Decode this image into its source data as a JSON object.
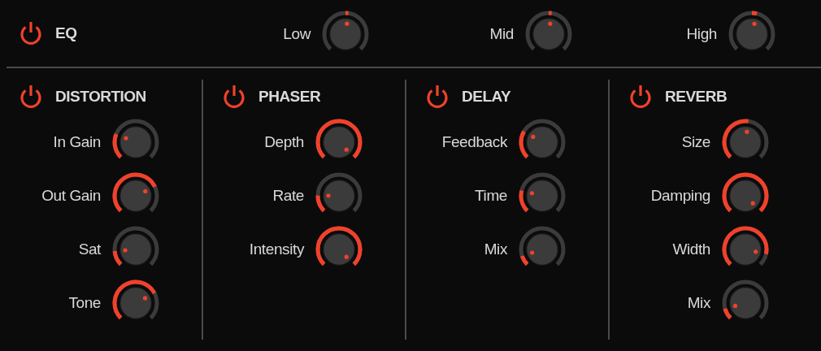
{
  "eq": {
    "title": "EQ",
    "on": true,
    "knobs": [
      {
        "label": "Low"
      },
      {
        "label": "Mid"
      },
      {
        "label": "High"
      }
    ]
  },
  "effects": [
    {
      "title": "DISTORTION",
      "on": true,
      "knobs": [
        {
          "label": "In Gain"
        },
        {
          "label": "Out Gain"
        },
        {
          "label": "Sat"
        },
        {
          "label": "Tone"
        }
      ]
    },
    {
      "title": "PHASER",
      "on": true,
      "knobs": [
        {
          "label": "Depth"
        },
        {
          "label": "Rate"
        },
        {
          "label": "Intensity"
        }
      ]
    },
    {
      "title": "DELAY",
      "on": true,
      "knobs": [
        {
          "label": "Feedback"
        },
        {
          "label": "Time"
        },
        {
          "label": "Mix"
        }
      ]
    },
    {
      "title": "REVERB",
      "on": true,
      "knobs": [
        {
          "label": "Size"
        },
        {
          "label": "Damping"
        },
        {
          "label": "Width"
        },
        {
          "label": "Mix"
        }
      ]
    }
  ]
}
